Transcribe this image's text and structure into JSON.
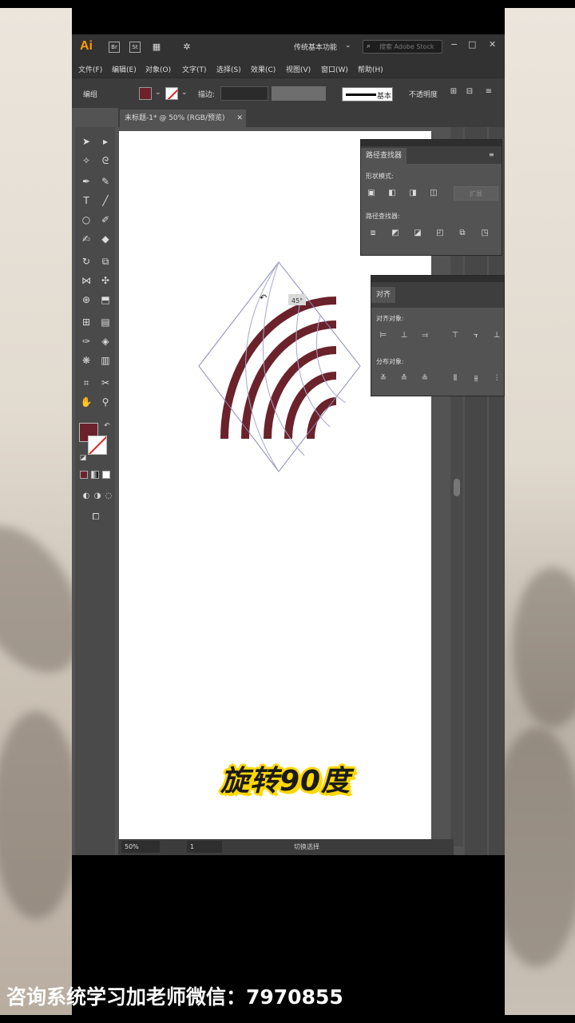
{
  "app": {
    "logo": "Ai",
    "bridge_labels": [
      "Br",
      "St"
    ],
    "workspace": "传统基本功能",
    "search_placeholder": "搜索 Adobe Stock",
    "window_controls": [
      "−",
      "□",
      "✕"
    ]
  },
  "menu": [
    "文件(F)",
    "编辑(E)",
    "对象(O)",
    "文字(T)",
    "选择(S)",
    "效果(C)",
    "视图(V)",
    "窗口(W)",
    "帮助(H)"
  ],
  "control_bar": {
    "selection_label": "编组",
    "stroke_label": "描边:",
    "brush_label": "基本",
    "opacity_label": "不透明度",
    "fill_color": "#6b222b",
    "stroke_color": "none"
  },
  "document": {
    "tab_title": "未标题-1* @ 50% (RGB/预览)",
    "close": "✕",
    "rotation_badge": "45°"
  },
  "pathfinder": {
    "title": "路径查找器",
    "shape_modes_label": "形状模式:",
    "pathfinders_label": "路径查找器:",
    "expand_label": "扩展"
  },
  "align": {
    "title": "对齐",
    "align_objects_label": "对齐对象:",
    "distribute_objects_label": "分布对象:"
  },
  "status": {
    "zoom": "50%",
    "artboard": "1",
    "mode": "切换选择"
  },
  "caption": "旋转90度",
  "footer_ad": "咨询系统学习加老师微信：7970855",
  "colors": {
    "accent": "#6b222b",
    "caption_outline": "#ffd800"
  }
}
